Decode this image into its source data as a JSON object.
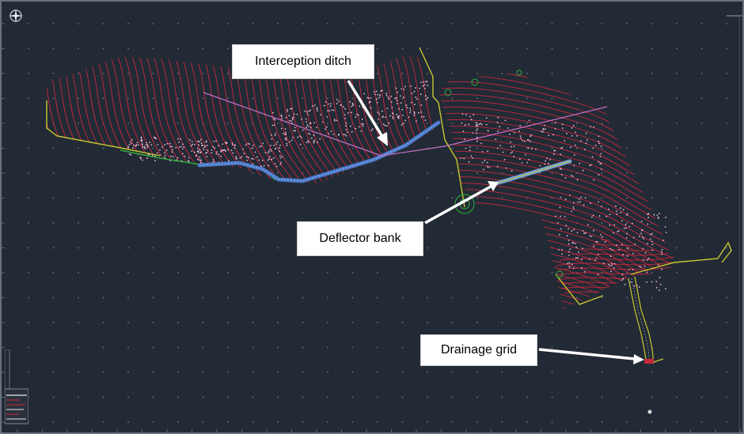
{
  "labels": {
    "interception_ditch": "Interception ditch",
    "deflector_bank": "Deflector bank",
    "drainage_grid": "Drainage grid"
  },
  "colors": {
    "background": "#222a35",
    "contour": "#c8283c",
    "boundary": "#c9c832",
    "ditch": "#4a78c8",
    "grid_dot": "#5f6875",
    "arrow": "#ffffff",
    "survey_points": "#e6a0c8",
    "green_line": "#2fae3f",
    "magenta_line": "#c86ec8"
  },
  "icons": {
    "compass": "compass-icon",
    "ucs": "ucs-icon"
  }
}
